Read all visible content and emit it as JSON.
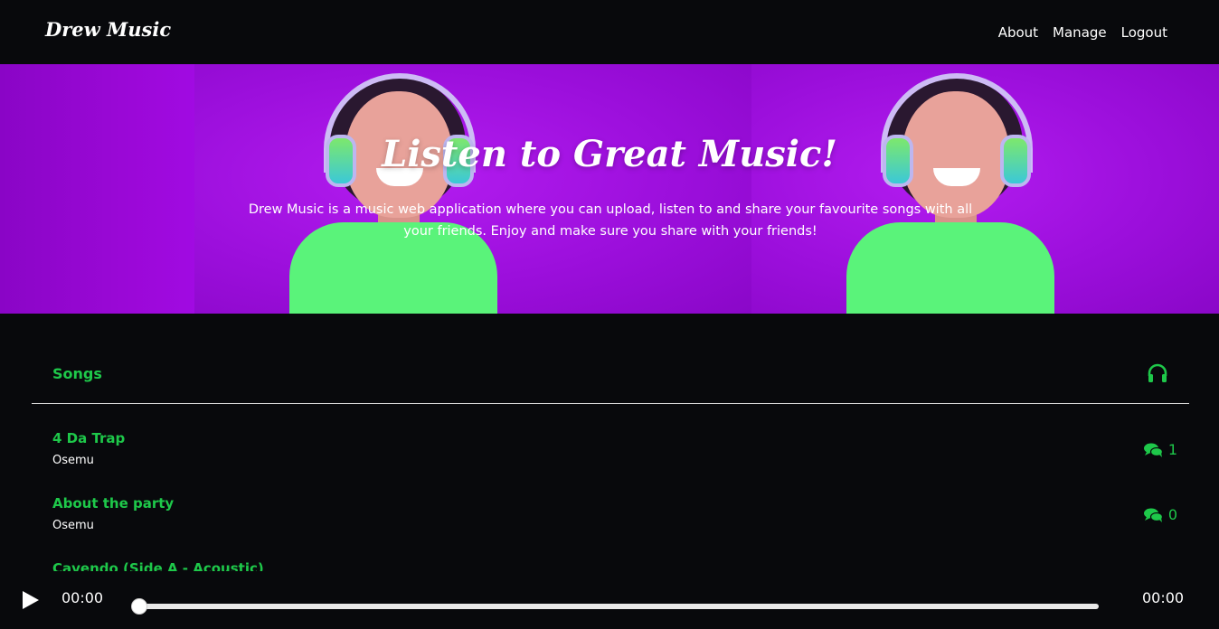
{
  "navbar": {
    "brand": "Drew Music",
    "links": [
      "About",
      "Manage",
      "Logout"
    ]
  },
  "hero": {
    "title": "Listen to Great Music!",
    "subtitle": "Drew Music is a music web application where you can upload, listen to and share your favourite songs with all your friends. Enjoy and make sure you share with your friends!",
    "image_subject": "woman-with-headphones"
  },
  "songs": {
    "header": "Songs",
    "header_icon": "headphones-icon",
    "items": [
      {
        "title": "4 Da Trap",
        "artist": "Osemu",
        "comments": "1"
      },
      {
        "title": "About the party",
        "artist": "Osemu",
        "comments": "0"
      },
      {
        "title": "Cavendo (Side A - Acoustic)",
        "artist": "",
        "comments": ""
      }
    ]
  },
  "player": {
    "current_time": "00:00",
    "total_time": "00:00",
    "progress": 0,
    "play_icon": "play-icon"
  },
  "colors": {
    "accent": "#1ec84a",
    "background": "#08090c",
    "hero_purple": "#9b0fde"
  }
}
